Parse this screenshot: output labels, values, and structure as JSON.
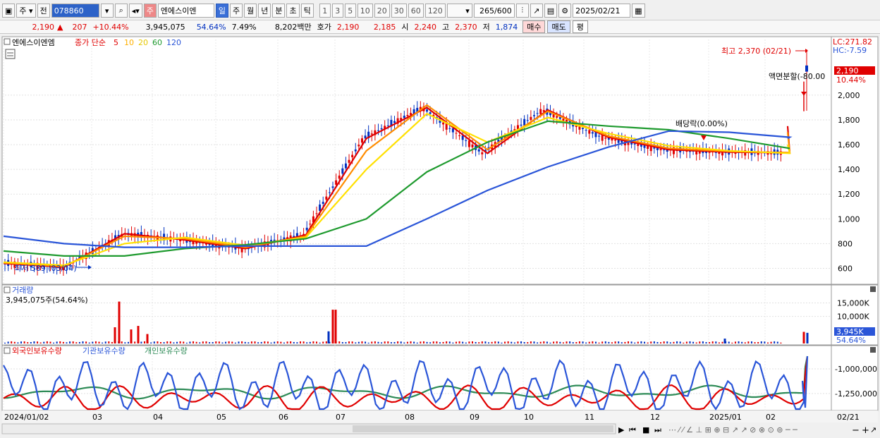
{
  "toolbar": {
    "period_type": "주",
    "prev": "전",
    "code": "078860",
    "mode": "주",
    "name": "엔에스이엔",
    "periods": [
      "일",
      "주",
      "월",
      "년",
      "분",
      "초",
      "틱"
    ],
    "selected_period": "일",
    "nums": [
      "1",
      "3",
      "5",
      "10",
      "20",
      "30",
      "60",
      "120"
    ],
    "count": "265",
    "count_max": "/600",
    "date": "2025/02/21"
  },
  "quote": {
    "price": "2,190",
    "change_arrow": "▲",
    "change": "207",
    "change_pct": "+10.44%",
    "volume": "3,945,075",
    "vol_ratio": "54.64%",
    "turnover": "7.49%",
    "amount": "8,202백만",
    "hoga_label": "호가",
    "ask": "2,190",
    "bid": "2,185",
    "open_label": "시",
    "open": "2,240",
    "high_label": "고",
    "high": "2,370",
    "low_label": "저",
    "low": "1,874",
    "buy": "매수",
    "sell": "매도",
    "eq": "평"
  },
  "colors": {
    "up": "#e00000",
    "down": "#0030c0",
    "ma5": "#e00000",
    "ma10": "#ff8c00",
    "ma20": "#ffe000",
    "ma60": "#1e9a2e",
    "ma120": "#2a55d8",
    "foreign": "#e00000",
    "institution": "#2a55d8",
    "individual": "#2e8b57"
  },
  "price_panel": {
    "stock_name": "엔에스이엔엠",
    "legend_title": "종가 단순",
    "ma_periods": [
      "5",
      "10",
      "20",
      "60",
      "120"
    ],
    "lc": "LC:271.82",
    "hc": "HC:-7.59",
    "high_note": "최고 2,370 (02/21)",
    "low_note": "최저 589 (03/04)",
    "split_note": "액면분할(-80.00",
    "dividend_note": "배당락(0.00%)",
    "current_price": "2,190",
    "current_pct": "10.44%",
    "y_ticks": [
      "2,000",
      "1,800",
      "1,600",
      "1,400",
      "1,200",
      "1,000",
      "800",
      "600"
    ]
  },
  "volume_panel": {
    "title": "거래량",
    "value": "3,945,075주(54.64%)",
    "y_ticks": [
      "15,000K",
      "10,000K"
    ],
    "current": "3,945K",
    "current_pct": "54.64%"
  },
  "holdings_panel": {
    "legend": [
      "외국인보유수량",
      "기관보유수량",
      "개인보유수량"
    ],
    "y_ticks": [
      "-1,000,000",
      "-1,250,000"
    ]
  },
  "x_axis": {
    "labels": [
      "2024/01/02",
      "03",
      "04",
      "05",
      "06",
      "07",
      "08",
      "09",
      "10",
      "11",
      "12",
      "2025/01",
      "02"
    ],
    "right_label": "02/21"
  },
  "chart_data": [
    {
      "type": "line",
      "title": "",
      "x": [
        "2024/01/02",
        "02",
        "03",
        "04",
        "05",
        "06",
        "07",
        "08",
        "09",
        "10",
        "11",
        "12",
        "2025/01",
        "02",
        "02/21"
      ],
      "series": [
        {
          "name": "5",
          "values": [
            640,
            610,
            880,
            830,
            760,
            870,
            1650,
            1900,
            1530,
            1880,
            1660,
            1560,
            1540,
            1535,
            1750
          ]
        },
        {
          "name": "10",
          "values": [
            645,
            615,
            860,
            840,
            770,
            860,
            1550,
            1920,
            1560,
            1870,
            1670,
            1570,
            1545,
            1535,
            1700
          ]
        },
        {
          "name": "20",
          "values": [
            650,
            625,
            800,
            850,
            785,
            850,
            1400,
            1850,
            1620,
            1820,
            1690,
            1590,
            1550,
            1530,
            1600
          ]
        },
        {
          "name": "60",
          "values": [
            740,
            700,
            700,
            760,
            790,
            840,
            1000,
            1380,
            1620,
            1790,
            1750,
            1720,
            1650,
            1570,
            1570
          ]
        },
        {
          "name": "120",
          "values": [
            860,
            800,
            770,
            770,
            780,
            780,
            780,
            1000,
            1230,
            1420,
            1580,
            1710,
            1700,
            1660,
            1650
          ]
        }
      ],
      "ylim": [
        500,
        2450
      ]
    },
    {
      "type": "bar",
      "title": "거래량",
      "categories": [
        "2024/03",
        "2024/03",
        "2024/04",
        "2024/06",
        "2024/07",
        "2025/02/21"
      ],
      "values": [
        6000,
        15500,
        8000,
        4000,
        12500,
        3945
      ],
      "ylim": [
        0,
        18000
      ]
    }
  ]
}
